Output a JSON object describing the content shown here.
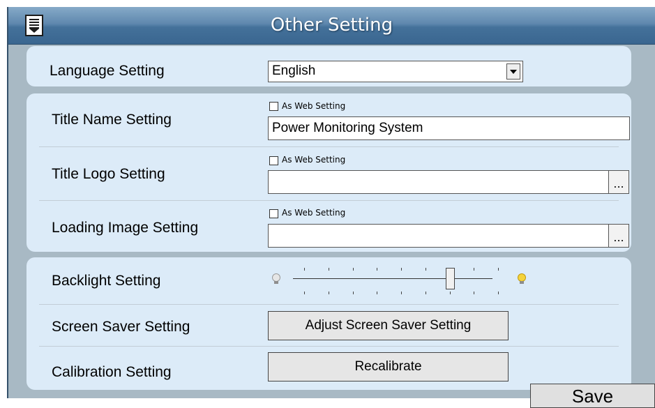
{
  "window": {
    "title": "Other Setting"
  },
  "language": {
    "label": "Language Setting",
    "selected": "English"
  },
  "title_name": {
    "label": "Title Name Setting",
    "checkbox_label": "As Web Setting",
    "checked": false,
    "value": "Power Monitoring System"
  },
  "title_logo": {
    "label": "Title Logo Setting",
    "checkbox_label": "As Web Setting",
    "checked": false,
    "value": "",
    "browse_label": "..."
  },
  "loading_image": {
    "label": "Loading Image Setting",
    "checkbox_label": "As Web Setting",
    "checked": false,
    "value": "",
    "browse_label": "..."
  },
  "backlight": {
    "label": "Backlight Setting",
    "level": 0.75
  },
  "screen_saver": {
    "label": "Screen Saver Setting",
    "button_label": "Adjust Screen Saver Setting"
  },
  "calibration": {
    "label": "Calibration Setting",
    "button_label": "Recalibrate"
  },
  "save": {
    "label": "Save"
  },
  "icons": {
    "menu": "menu-icon",
    "bulb_dim": "bulb-dim-icon",
    "bulb_bright": "bulb-bright-icon"
  },
  "colors": {
    "title_bar": "#4e7aa3",
    "panel": "#dcebf8",
    "frame": "#a8b9c4"
  }
}
